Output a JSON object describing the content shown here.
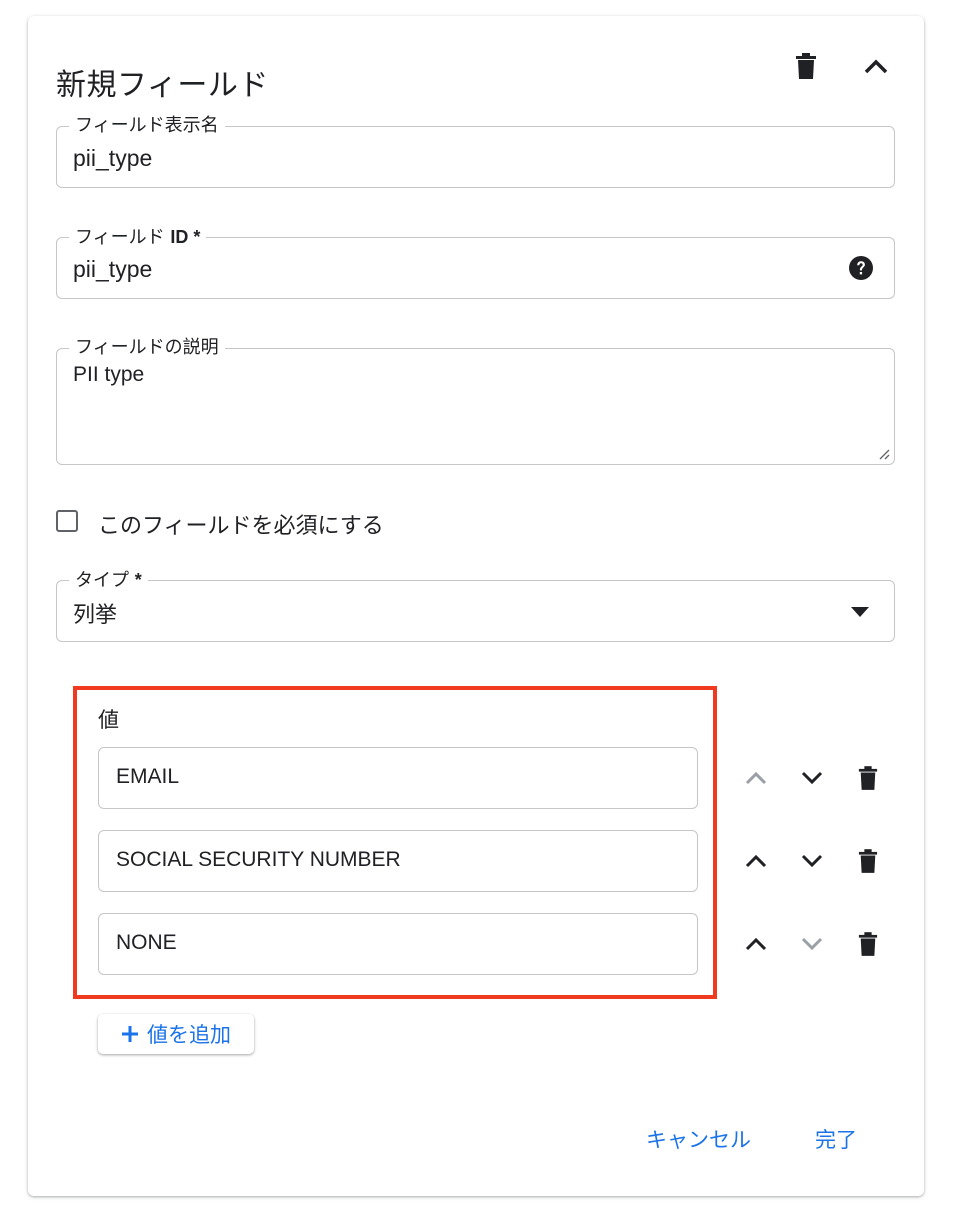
{
  "header": {
    "title": "新規フィールド",
    "delete_icon": "trash-icon",
    "collapse_icon": "chevron-up-icon"
  },
  "display_name": {
    "label": "フィールド表示名",
    "value": "pii_type"
  },
  "field_id": {
    "label": "フィールド",
    "label_strong": "ID *",
    "value": "pii_type",
    "help_icon": "help-circle-icon"
  },
  "description": {
    "label": "フィールドの説明",
    "value": "PII type"
  },
  "required": {
    "label": "このフィールドを必須にする",
    "checked": false
  },
  "type": {
    "label": "タイプ",
    "label_strong": "*",
    "value": "列挙",
    "dropdown_icon": "caret-down-icon"
  },
  "values": {
    "title": "値",
    "items": [
      {
        "label": "EMAIL",
        "move_up_enabled": false,
        "move_down_enabled": true
      },
      {
        "label": "SOCIAL SECURITY NUMBER",
        "move_up_enabled": true,
        "move_down_enabled": true
      },
      {
        "label": "NONE",
        "move_up_enabled": true,
        "move_down_enabled": false
      }
    ],
    "add_label": "値を追加"
  },
  "footer": {
    "cancel_label": "キャンセル",
    "done_label": "完了"
  },
  "colors": {
    "accent": "#1a73e8",
    "highlight": "#f03a1f",
    "disabled": "#9aa0a6"
  }
}
